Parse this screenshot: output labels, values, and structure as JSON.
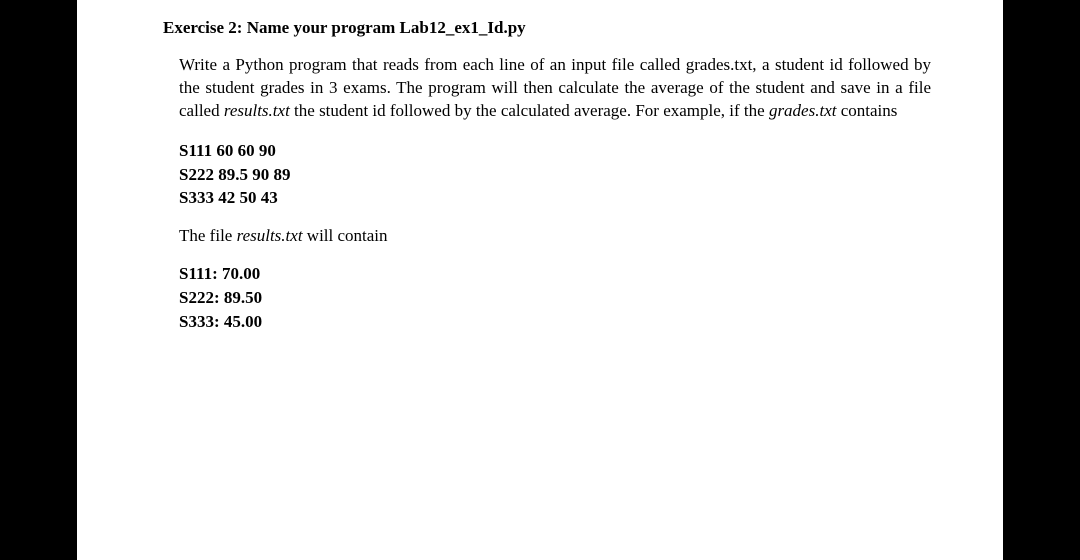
{
  "heading": "Exercise 2: Name your program Lab12_ex1_Id.py",
  "paragraph": {
    "part1": "Write a Python program that reads from each line of an input file called grades.txt, a student id followed by the student grades in 3 exams. The program will then calculate the average of the student and save in a file called ",
    "italic1": "results.txt",
    "part2": " the student id followed by the calculated average. For example, if the ",
    "italic2": "grades.txt",
    "part3": " contains"
  },
  "grades": [
    "S111 60 60 90",
    "S222 89.5 90 89",
    "S333 42 50 43"
  ],
  "caption": {
    "part1": "The file ",
    "italic1": "results.txt",
    "part2": " will contain"
  },
  "results": [
    "S111: 70.00",
    "S222: 89.50",
    "S333: 45.00"
  ]
}
